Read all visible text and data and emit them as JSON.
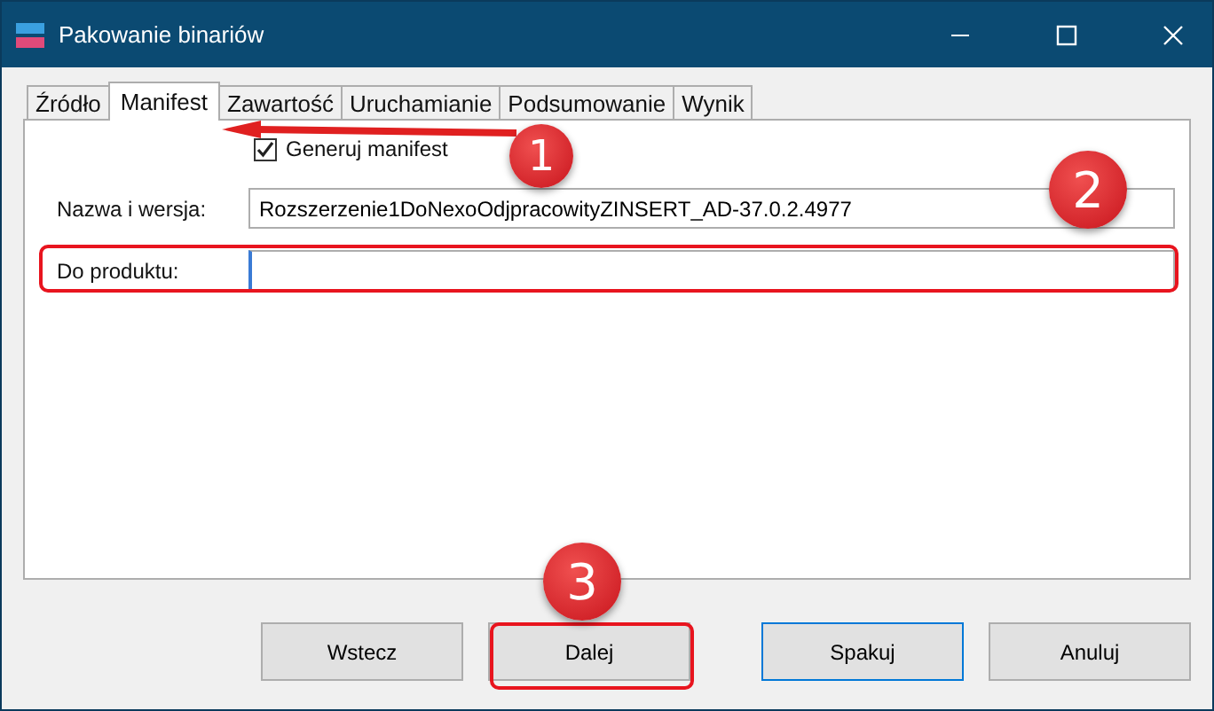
{
  "window": {
    "title": "Pakowanie binariów"
  },
  "tabs": [
    {
      "label": "Źródło",
      "selected": false
    },
    {
      "label": "Manifest",
      "selected": true
    },
    {
      "label": "Zawartość",
      "selected": false
    },
    {
      "label": "Uruchamianie",
      "selected": false
    },
    {
      "label": "Podsumowanie",
      "selected": false
    },
    {
      "label": "Wynik",
      "selected": false
    }
  ],
  "generate_manifest": {
    "label": "Generuj manifest",
    "checked": true
  },
  "fields": [
    {
      "label": "Nazwa i wersja:",
      "value": "Rozszerzenie1DoNexoOdjpracowityZINSERT_AD-37.0.2.4977",
      "focused": false
    },
    {
      "label": "Do produktu:",
      "focused": true
    }
  ],
  "buttons": [
    {
      "label": "Wstecz",
      "default": false
    },
    {
      "label": "Dalej",
      "default": false
    },
    {
      "label": "Spakuj",
      "default": true
    },
    {
      "label": "Anuluj",
      "default": false
    }
  ],
  "annotations": [
    "1",
    "2",
    "3"
  ]
}
